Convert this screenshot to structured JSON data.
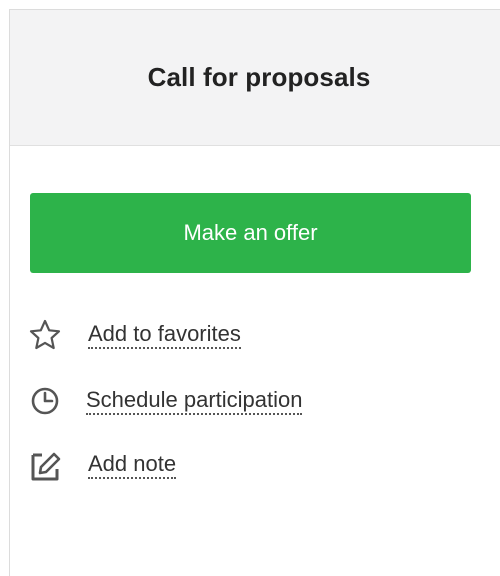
{
  "header": {
    "title": "Call for proposals"
  },
  "primary_action": {
    "label": "Make an offer",
    "color": "#2db34a"
  },
  "actions": [
    {
      "label": "Add to favorites",
      "icon": "star-outline-icon"
    },
    {
      "label": "Schedule participation",
      "icon": "clock-icon"
    },
    {
      "label": "Add note",
      "icon": "edit-note-icon"
    }
  ]
}
